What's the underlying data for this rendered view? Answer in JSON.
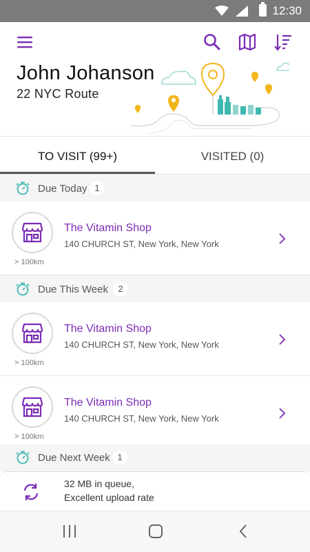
{
  "status_bar": {
    "time": "12:30"
  },
  "header": {
    "user_name": "John Johanson",
    "route_name": "22 NYC Route"
  },
  "tabs": [
    {
      "label": "TO VISIT (99+)",
      "active": true
    },
    {
      "label": "VISITED (0)",
      "active": false
    }
  ],
  "sections": [
    {
      "label": "Due Today",
      "count": "1"
    },
    {
      "label": "Due This Week",
      "count": "2"
    },
    {
      "label": "Due Next Week",
      "count": "1"
    }
  ],
  "stores": [
    {
      "name": "The Vitamin Shop",
      "address": "140 CHURCH ST, New York, New York",
      "distance": "> 100km"
    },
    {
      "name": "The Vitamin Shop",
      "address": "140 CHURCH ST, New York, New York",
      "distance": "> 100km"
    },
    {
      "name": "The Vitamin Shop",
      "address": "140 CHURCH ST, New York, New York",
      "distance": "> 100km"
    }
  ],
  "upload": {
    "line1": "32 MB in queue,",
    "line2": "Excellent upload rate"
  },
  "icons": {
    "menu": "menu-icon",
    "search": "search-icon",
    "map": "map-icon",
    "sort": "sort-icon",
    "timer": "timer-icon",
    "store": "store-icon",
    "chevron": "chevron-right-icon",
    "sync": "sync-icon"
  },
  "colors": {
    "accent": "#7b2bb5",
    "teal": "#3fb8b0",
    "pin_yellow": "#f2b61c",
    "status_bar": "#7b7b7b"
  }
}
